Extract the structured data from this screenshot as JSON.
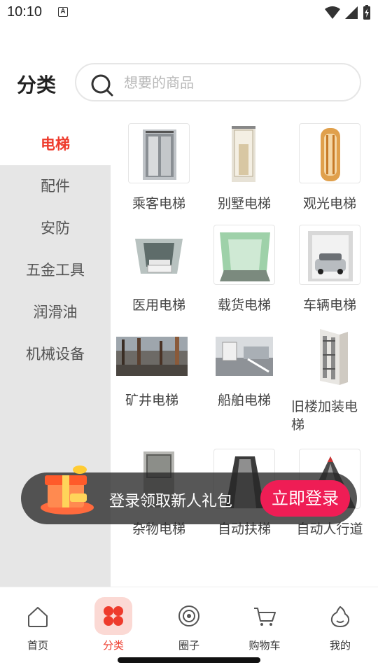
{
  "status_bar": {
    "time": "10:10",
    "notif_letter": "A"
  },
  "header": {
    "title": "分类"
  },
  "search": {
    "placeholder": "想要的商品"
  },
  "sidebar": {
    "items": [
      {
        "label": "电梯",
        "active": true
      },
      {
        "label": "配件",
        "active": false
      },
      {
        "label": "安防",
        "active": false
      },
      {
        "label": "五金工具",
        "active": false
      },
      {
        "label": "润滑油",
        "active": false
      },
      {
        "label": "机械设备",
        "active": false
      }
    ]
  },
  "products": [
    {
      "label": "乘客电梯",
      "icon": "passenger-elevator-image"
    },
    {
      "label": "别墅电梯",
      "icon": "villa-elevator-image"
    },
    {
      "label": "观光电梯",
      "icon": "sightseeing-elevator-image"
    },
    {
      "label": "医用电梯",
      "icon": "medical-elevator-image"
    },
    {
      "label": "载货电梯",
      "icon": "freight-elevator-image"
    },
    {
      "label": "车辆电梯",
      "icon": "car-elevator-image"
    },
    {
      "label": "矿井电梯",
      "icon": "mine-elevator-image"
    },
    {
      "label": "船舶电梯",
      "icon": "ship-elevator-image"
    },
    {
      "label": "旧楼加装电梯",
      "icon": "retrofit-elevator-image"
    },
    {
      "label": "杂物电梯",
      "icon": "dumbwaiter-image"
    },
    {
      "label": "自动扶梯",
      "icon": "escalator-image"
    },
    {
      "label": "自动人行道",
      "icon": "moving-walkway-image"
    }
  ],
  "banner": {
    "text": "登录领取新人礼包",
    "button": "立即登录"
  },
  "tabbar": {
    "items": [
      {
        "label": "首页",
        "icon": "home-icon"
      },
      {
        "label": "分类",
        "icon": "category-icon",
        "active": true
      },
      {
        "label": "圈子",
        "icon": "circle-icon"
      },
      {
        "label": "购物车",
        "icon": "cart-icon"
      },
      {
        "label": "我的",
        "icon": "profile-icon"
      }
    ]
  },
  "colors": {
    "accent": "#ee3b2c",
    "login_button": "#ef1d55",
    "sidebar_bg": "#e6e6e6"
  }
}
